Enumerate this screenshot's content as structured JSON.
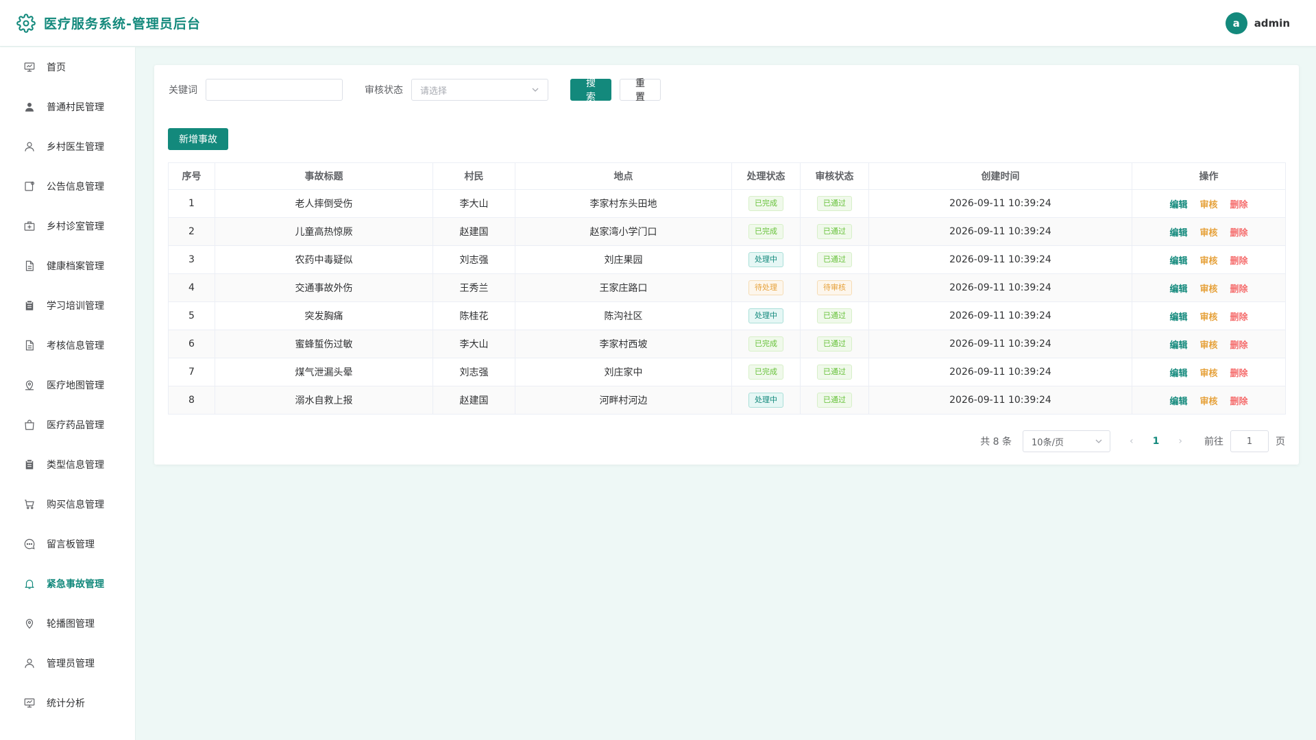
{
  "header": {
    "title": "医疗服务系统-管理员后台",
    "user_initial": "a",
    "username": "admin",
    "brand_color": "#13897c"
  },
  "sidebar": {
    "items": [
      {
        "label": "首页",
        "icon": "dashboard-icon"
      },
      {
        "label": "普通村民管理",
        "icon": "user-filled-icon"
      },
      {
        "label": "乡村医生管理",
        "icon": "user-icon"
      },
      {
        "label": "公告信息管理",
        "icon": "notice-icon"
      },
      {
        "label": "乡村诊室管理",
        "icon": "first-aid-kit-icon"
      },
      {
        "label": "健康档案管理",
        "icon": "document-icon"
      },
      {
        "label": "学习培训管理",
        "icon": "clipboard-icon"
      },
      {
        "label": "考核信息管理",
        "icon": "document-icon"
      },
      {
        "label": "医疗地图管理",
        "icon": "map-location-icon"
      },
      {
        "label": "医疗药品管理",
        "icon": "shopping-bag-icon"
      },
      {
        "label": "类型信息管理",
        "icon": "clipboard-icon"
      },
      {
        "label": "购买信息管理",
        "icon": "shopping-cart-icon"
      },
      {
        "label": "留言板管理",
        "icon": "chat-icon"
      },
      {
        "label": "紧急事故管理",
        "icon": "bell-icon",
        "active": true
      },
      {
        "label": "轮播图管理",
        "icon": "location-icon"
      },
      {
        "label": "管理员管理",
        "icon": "user-icon"
      },
      {
        "label": "统计分析",
        "icon": "chart-icon"
      }
    ]
  },
  "filter": {
    "keyword_label": "关键词",
    "keyword_value": "",
    "audit_label": "审核状态",
    "audit_placeholder": "请选择",
    "search_label": "搜索",
    "reset_label": "重置"
  },
  "add_button_label": "新增事故",
  "table": {
    "columns": [
      "序号",
      "事故标题",
      "村民",
      "地点",
      "处理状态",
      "审核状态",
      "创建时间",
      "操作"
    ],
    "rows": [
      {
        "no": "1",
        "title": "老人摔倒受伤",
        "villager": "李大山",
        "location": "李家村东头田地",
        "handle": "已完成",
        "handle_type": "success",
        "audit": "已通过",
        "audit_type": "success",
        "time": "2026-09-11 10:39:24"
      },
      {
        "no": "2",
        "title": "儿童高热惊厥",
        "villager": "赵建国",
        "location": "赵家湾小学门口",
        "handle": "已完成",
        "handle_type": "success",
        "audit": "已通过",
        "audit_type": "success",
        "time": "2026-09-11 10:39:24"
      },
      {
        "no": "3",
        "title": "农药中毒疑似",
        "villager": "刘志强",
        "location": "刘庄果园",
        "handle": "处理中",
        "handle_type": "info",
        "audit": "已通过",
        "audit_type": "success",
        "time": "2026-09-11 10:39:24"
      },
      {
        "no": "4",
        "title": "交通事故外伤",
        "villager": "王秀兰",
        "location": "王家庄路口",
        "handle": "待处理",
        "handle_type": "warning",
        "audit": "待审核",
        "audit_type": "warning",
        "time": "2026-09-11 10:39:24"
      },
      {
        "no": "5",
        "title": "突发胸痛",
        "villager": "陈桂花",
        "location": "陈沟社区",
        "handle": "处理中",
        "handle_type": "info",
        "audit": "已通过",
        "audit_type": "success",
        "time": "2026-09-11 10:39:24"
      },
      {
        "no": "6",
        "title": "蜜蜂蜇伤过敏",
        "villager": "李大山",
        "location": "李家村西坡",
        "handle": "已完成",
        "handle_type": "success",
        "audit": "已通过",
        "audit_type": "success",
        "time": "2026-09-11 10:39:24"
      },
      {
        "no": "7",
        "title": "煤气泄漏头晕",
        "villager": "刘志强",
        "location": "刘庄家中",
        "handle": "已完成",
        "handle_type": "success",
        "audit": "已通过",
        "audit_type": "success",
        "time": "2026-09-11 10:39:24"
      },
      {
        "no": "8",
        "title": "溺水自救上报",
        "villager": "赵建国",
        "location": "河畔村河边",
        "handle": "处理中",
        "handle_type": "info",
        "audit": "已通过",
        "audit_type": "success",
        "time": "2026-09-11 10:39:24"
      }
    ],
    "actions": {
      "edit": "编辑",
      "audit": "审核",
      "delete": "删除"
    }
  },
  "pagination": {
    "total_text": "共 8 条",
    "page_size": "10条/页",
    "current_page": "1",
    "goto_label": "前往",
    "goto_value": "1",
    "page_suffix": "页"
  }
}
